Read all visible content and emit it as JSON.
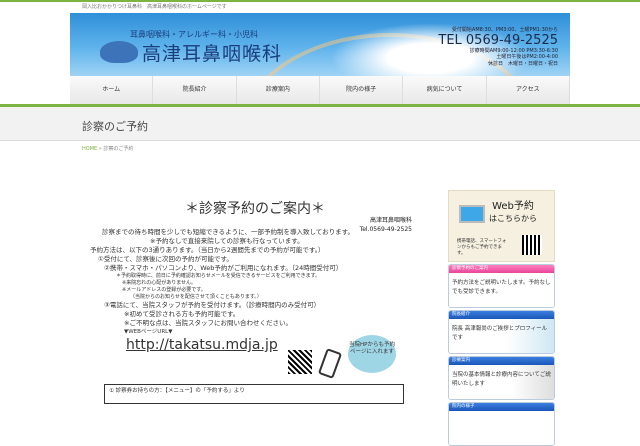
{
  "header": {
    "tagline": "岡入比おかかりつけ耳鼻科　高津耳鼻咽喉科のホームページです",
    "subtitle": "耳鼻咽喉科・アレルギー科・小児科",
    "clinic_name": "高津耳鼻咽喉科",
    "contact": {
      "reception": "受付開始AM8:30、PM3:00、土曜PM1:30から",
      "tel": "TEL 0569-49-2525",
      "hours": "診療時間AM9:00-12:00 PM3:30-6:30",
      "saturday": "土曜日午後はPM2:00-4:00",
      "closed": "休診日　木曜日・日曜日・祝日"
    }
  },
  "nav": [
    "ホーム",
    "院長紹介",
    "診療案内",
    "院内の様子",
    "病気について",
    "アクセス"
  ],
  "page_title": "診察のご予約",
  "breadcrumb": {
    "home": "HOME",
    "sep": " » ",
    "current": "診察のご予約"
  },
  "main": {
    "heading": "＊診察予約のご案内＊",
    "clinic": "高津耳鼻咽喉科",
    "clinic_tel": "Tel.0569-49-2525",
    "lines": [
      "診察までの待ち時間を少しでも短縮できるように、一部予約制を導入致しております。",
      "※予約なしで直接来院しての診察も行なっています。",
      "予約方法は、以下の3通りあります。（当日から2週間先までの予約が可能です。）",
      "①受付にて、診察後に次回の予約が可能です。",
      "②携帯・スマホ・パソコンより、Web予約がご利用になれます。（24時間受付可）",
      "＊予約取得時に、前日に予約確認お知らせメールを受信できるサービスをご利用できます。",
      "※来院忘れの心配がありません。",
      "※メールアドレスの登録が必要です。",
      "（当院からのお知らせを配信させて頂くこともあります。）",
      "③電話にて、当院スタッフが予約を受付けます。（診療時間内のみ受付可）",
      "※初めて受診される方も予約可能です。",
      "※ご不明な点は、当院スタッフにお問い合わせください。"
    ],
    "url_label": "▼WEBページURL▼",
    "url": "http://takatsu.mdja.jp",
    "bubble": "当院HPからも予約ページに入れます",
    "step1": "① 診察券お持ちの方：【メニュー】の「予約する」より"
  },
  "sidebar": {
    "web": {
      "title1": "Web予約",
      "title2": "はこちらから",
      "note": "携帯電話、スマートフォンからもご予約できます。"
    },
    "cards": [
      {
        "header": "診察予約のご案内",
        "body": "予約方法をご説明いたします。予約なしでも受診できます。"
      },
      {
        "header": "院長紹介",
        "body": "院長 高津報尚のご挨拶とプロフィールです"
      },
      {
        "header": "診療案内",
        "body": "当院の基本情報と診療内容についてご説明いたします"
      },
      {
        "header": "院内の様子",
        "body": ""
      }
    ]
  }
}
